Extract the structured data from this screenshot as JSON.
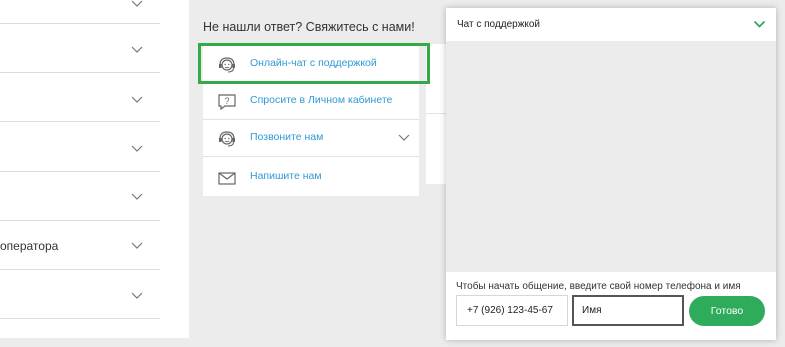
{
  "faq": {
    "items": [
      {
        "label": ""
      },
      {
        "label": ""
      },
      {
        "label": ""
      },
      {
        "label": ""
      },
      {
        "label": ""
      },
      {
        "label": "оператора"
      },
      {
        "label": ""
      }
    ]
  },
  "contact": {
    "title": "Не нашли ответ? Свяжитесь с нами!",
    "items": [
      {
        "label": "Онлайн-чат с поддержкой",
        "icon": "headset-icon"
      },
      {
        "label": "Спросите в Личном кабинете",
        "icon": "question-chat-icon"
      },
      {
        "label": "Позвоните нам",
        "icon": "headset-icon"
      },
      {
        "label": "Напишите нам",
        "icon": "envelope-icon"
      }
    ]
  },
  "chat": {
    "title": "Чат с поддержкой",
    "hint": "Чтобы начать общение, введите свой номер телефона и имя",
    "phone_value": "+7 (926) 123-45-67",
    "name_value": "Имя",
    "submit_label": "Готово"
  },
  "colors": {
    "accent_green": "#2eac5b",
    "highlight_green": "#36a84c",
    "link_blue": "#2f9ad3"
  }
}
